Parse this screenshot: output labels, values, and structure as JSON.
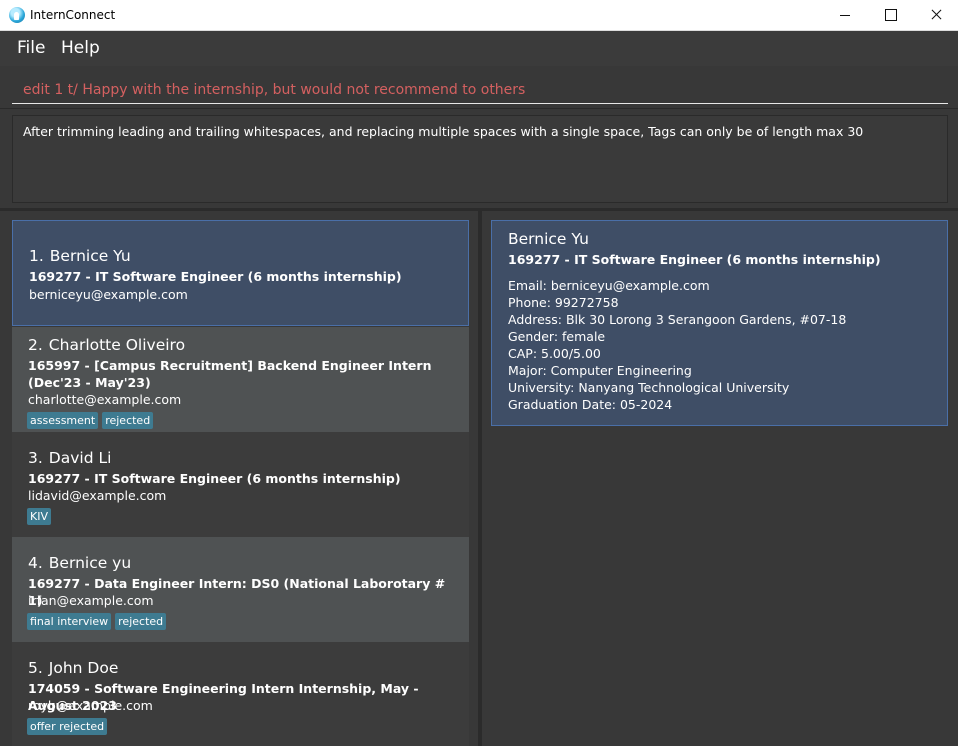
{
  "window": {
    "title": "InternConnect"
  },
  "menu": {
    "file": "File",
    "help": "Help"
  },
  "command": {
    "value": "edit 1 t/ Happy with the internship, but would not recommend to others"
  },
  "result": {
    "text": "After trimming leading and trailing whitespaces, and replacing multiple spaces with a single space, Tags can only be of length max 30"
  },
  "list": [
    {
      "index": "1.",
      "name": "Bernice Yu",
      "job": "169277 - IT Software Engineer (6 months internship)",
      "email": "berniceyu@example.com",
      "tags": []
    },
    {
      "index": "2.",
      "name": "Charlotte Oliveiro",
      "job": "165997 - [Campus Recruitment] Backend Engineer Intern (Dec'23 - May'23)",
      "email": "charlotte@example.com",
      "tags": [
        "assessment",
        "rejected"
      ]
    },
    {
      "index": "3.",
      "name": "David Li",
      "job": "169277 - IT Software Engineer (6 months internship)",
      "email": "lidavid@example.com",
      "tags": [
        "KIV"
      ]
    },
    {
      "index": "4.",
      "name": "Bernice yu",
      "job": "169277 - Data Engineer Intern: DS0 (National Laborotary # 1)",
      "email": "irfan@example.com",
      "tags": [
        "final interview",
        "rejected"
      ]
    },
    {
      "index": "5.",
      "name": "John Doe",
      "job": "174059 - Software Engineering Intern Internship, May - August 2023",
      "email": "royb@example.com",
      "tags": [
        "offer rejected"
      ]
    }
  ],
  "detail": {
    "name": "Bernice Yu",
    "job": "169277 - IT Software Engineer (6 months internship)",
    "email": "Email: berniceyu@example.com",
    "phone": "Phone: 99272758",
    "address": "Address: Blk 30 Lorong 3 Serangoon Gardens, #07-18",
    "gender": "Gender: female",
    "cap": "CAP: 5.00/5.00",
    "major": "Major: Computer Engineering",
    "university": "University: Nanyang Technological University",
    "graduation": "Graduation Date: 05-2024"
  },
  "colors": {
    "tag": "#3e7b91",
    "selected": "#3f4e66",
    "command_text": "#d46060"
  }
}
